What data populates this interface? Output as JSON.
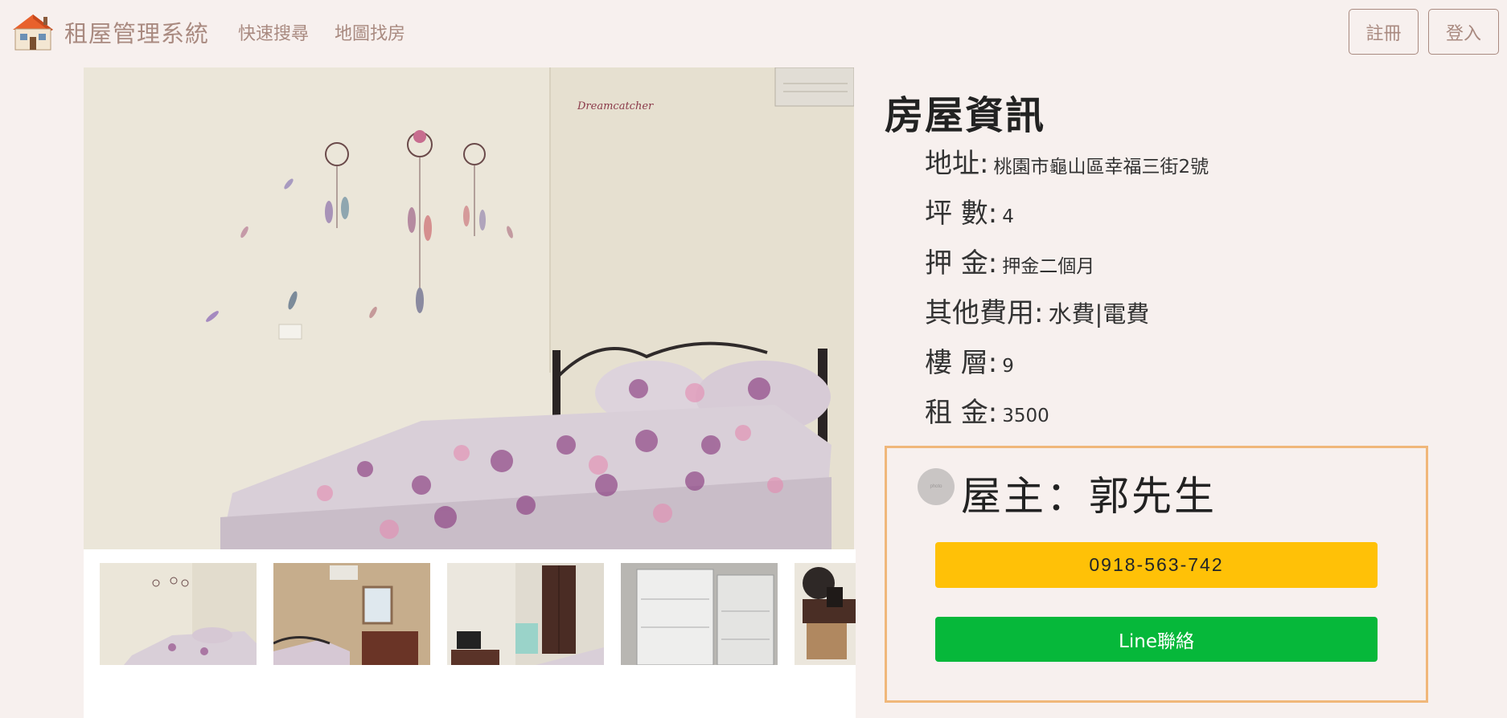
{
  "nav": {
    "brand": "租屋管理系統",
    "links": [
      "快速搜尋",
      "地圖找房"
    ],
    "register_label": "註冊",
    "login_label": "登入"
  },
  "gallery": {
    "thumbnail_count": 5
  },
  "info": {
    "title": "房屋資訊",
    "rows": [
      {
        "label": "地址:",
        "value": "桃園市龜山區幸福三街2號"
      },
      {
        "label": "坪 數:",
        "value": "4"
      },
      {
        "label": "押 金:",
        "value": "押金二個月"
      },
      {
        "label": "其他費用:",
        "value": "水費|電費"
      },
      {
        "label": "樓 層:",
        "value": "9"
      },
      {
        "label": "租 金:",
        "value": "3500"
      }
    ]
  },
  "landlord": {
    "name": "屋主：郭先生",
    "avatar_alt": "photo",
    "phone": "0918-563-742",
    "line_label": "Line聯絡"
  },
  "colors": {
    "background": "#f7f0ee",
    "nav_text": "#a98a80",
    "card_border": "#f0b77a",
    "phone_button": "#ffc107",
    "line_button": "#06b83a"
  }
}
